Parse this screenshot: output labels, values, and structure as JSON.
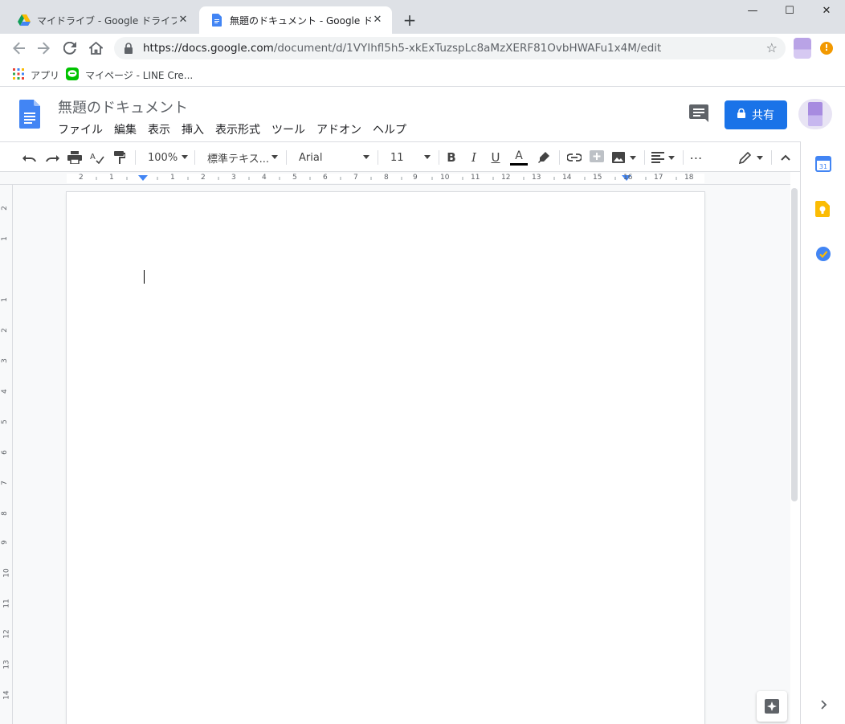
{
  "browser": {
    "tabs": [
      {
        "title": "マイドライブ - Google ドライブ",
        "active": false
      },
      {
        "title": "無題のドキュメント - Google ドキュメ",
        "active": true
      }
    ],
    "new_tab": "+",
    "window_controls": {
      "minimize": "—",
      "maximize": "☐",
      "close": "✕"
    },
    "url": {
      "domain": "https://docs.google.com",
      "path": "/document/d/1VYIhfl5h5-xkExTuzspLc8aMzXERF81OvbHWAFu1x4M/edit"
    },
    "bookmarks": [
      {
        "label": "アプリ",
        "icon": "apps-grid-icon"
      },
      {
        "label": "マイページ - LINE Cre...",
        "icon": "line-icon"
      }
    ]
  },
  "docs": {
    "title": "無題のドキュメント",
    "menu": [
      "ファイル",
      "編集",
      "表示",
      "挿入",
      "表示形式",
      "ツール",
      "アドオン",
      "ヘルプ"
    ],
    "share_label": "共有",
    "toolbar": {
      "zoom": "100%",
      "style": "標準テキス...",
      "font": "Arial",
      "font_size": "11"
    },
    "ruler_ticks": [
      "2",
      "1",
      "1",
      "2",
      "3",
      "4",
      "5",
      "6",
      "7",
      "8",
      "9",
      "10",
      "11",
      "12",
      "13",
      "14",
      "15",
      "16",
      "17",
      "18"
    ],
    "vruler_ticks": [
      "2",
      "1",
      "1",
      "2",
      "3",
      "4",
      "5",
      "6",
      "7",
      "8",
      "9",
      "10",
      "11",
      "12",
      "13",
      "14"
    ],
    "side_panel": [
      "calendar-icon",
      "keep-icon",
      "tasks-icon"
    ],
    "calendar_day": "31"
  },
  "colors": {
    "accent": "#1a73e8",
    "docs_blue": "#4285f4",
    "keep_yellow": "#fbbc04"
  }
}
